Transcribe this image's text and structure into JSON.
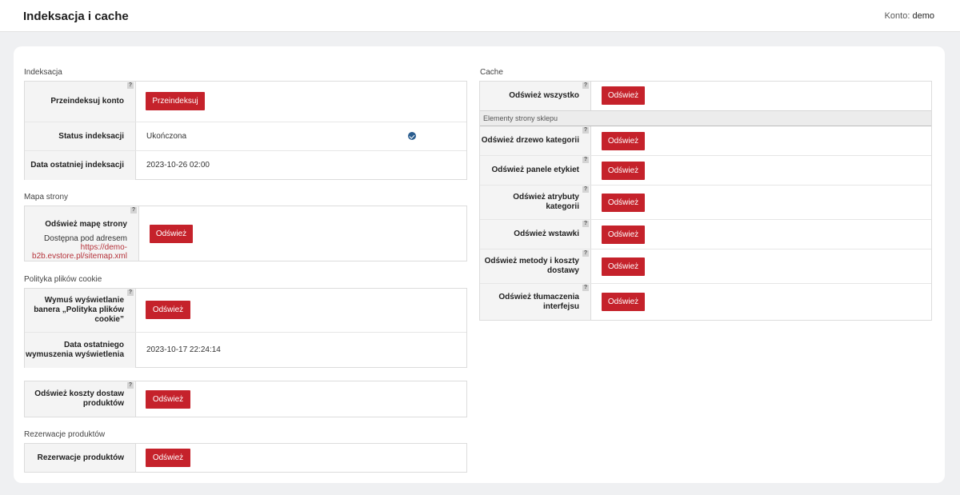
{
  "header": {
    "title": "Indeksacja i cache",
    "account_label": "Konto:",
    "account_name": "demo"
  },
  "indexing": {
    "title": "Indeksacja",
    "reindex_label": "Przeindeksuj konto",
    "reindex_button": "Przeindeksuj",
    "status_label": "Status indeksacji",
    "status_value": "Ukończona",
    "last_label": "Data ostatniej indeksacji",
    "last_value": "2023-10-26 02:00"
  },
  "sitemap": {
    "title": "Mapa strony",
    "refresh_label": "Odśwież mapę strony",
    "available_text": "Dostępna pod adresem",
    "url": "https://demo-b2b.evstore.pl/sitemap.xml",
    "button": "Odśwież"
  },
  "cookies": {
    "title": "Polityka plików cookie",
    "force_label": "Wymuś wyświetlanie banera „Polityka plików cookie”",
    "button": "Odśwież",
    "last_label": "Data ostatniego wymuszenia wyświetlenia",
    "last_value": "2023-10-17 22:24:14"
  },
  "shipping": {
    "label": "Odśwież koszty dostaw produktów",
    "button": "Odśwież"
  },
  "reservations": {
    "title": "Rezerwacje produktów",
    "label": "Rezerwacje produktów",
    "button": "Odśwież"
  },
  "cache": {
    "title": "Cache",
    "all_label": "Odśwież wszystko",
    "all_button": "Odśwież",
    "subheading": "Elementy strony sklepu",
    "items": [
      {
        "label": "Odśwież drzewo kategorii",
        "button": "Odśwież"
      },
      {
        "label": "Odśwież panele etykiet",
        "button": "Odśwież"
      },
      {
        "label": "Odśwież atrybuty kategorii",
        "button": "Odśwież"
      },
      {
        "label": "Odśwież wstawki",
        "button": "Odśwież"
      },
      {
        "label": "Odśwież metody i koszty dostawy",
        "button": "Odśwież"
      },
      {
        "label": "Odśwież tłumaczenia interfejsu",
        "button": "Odśwież"
      }
    ]
  },
  "help_mark": "?",
  "colors": {
    "accent": "#c5222b",
    "link": "#b5323a",
    "status_ok": "#2a5d8f"
  }
}
